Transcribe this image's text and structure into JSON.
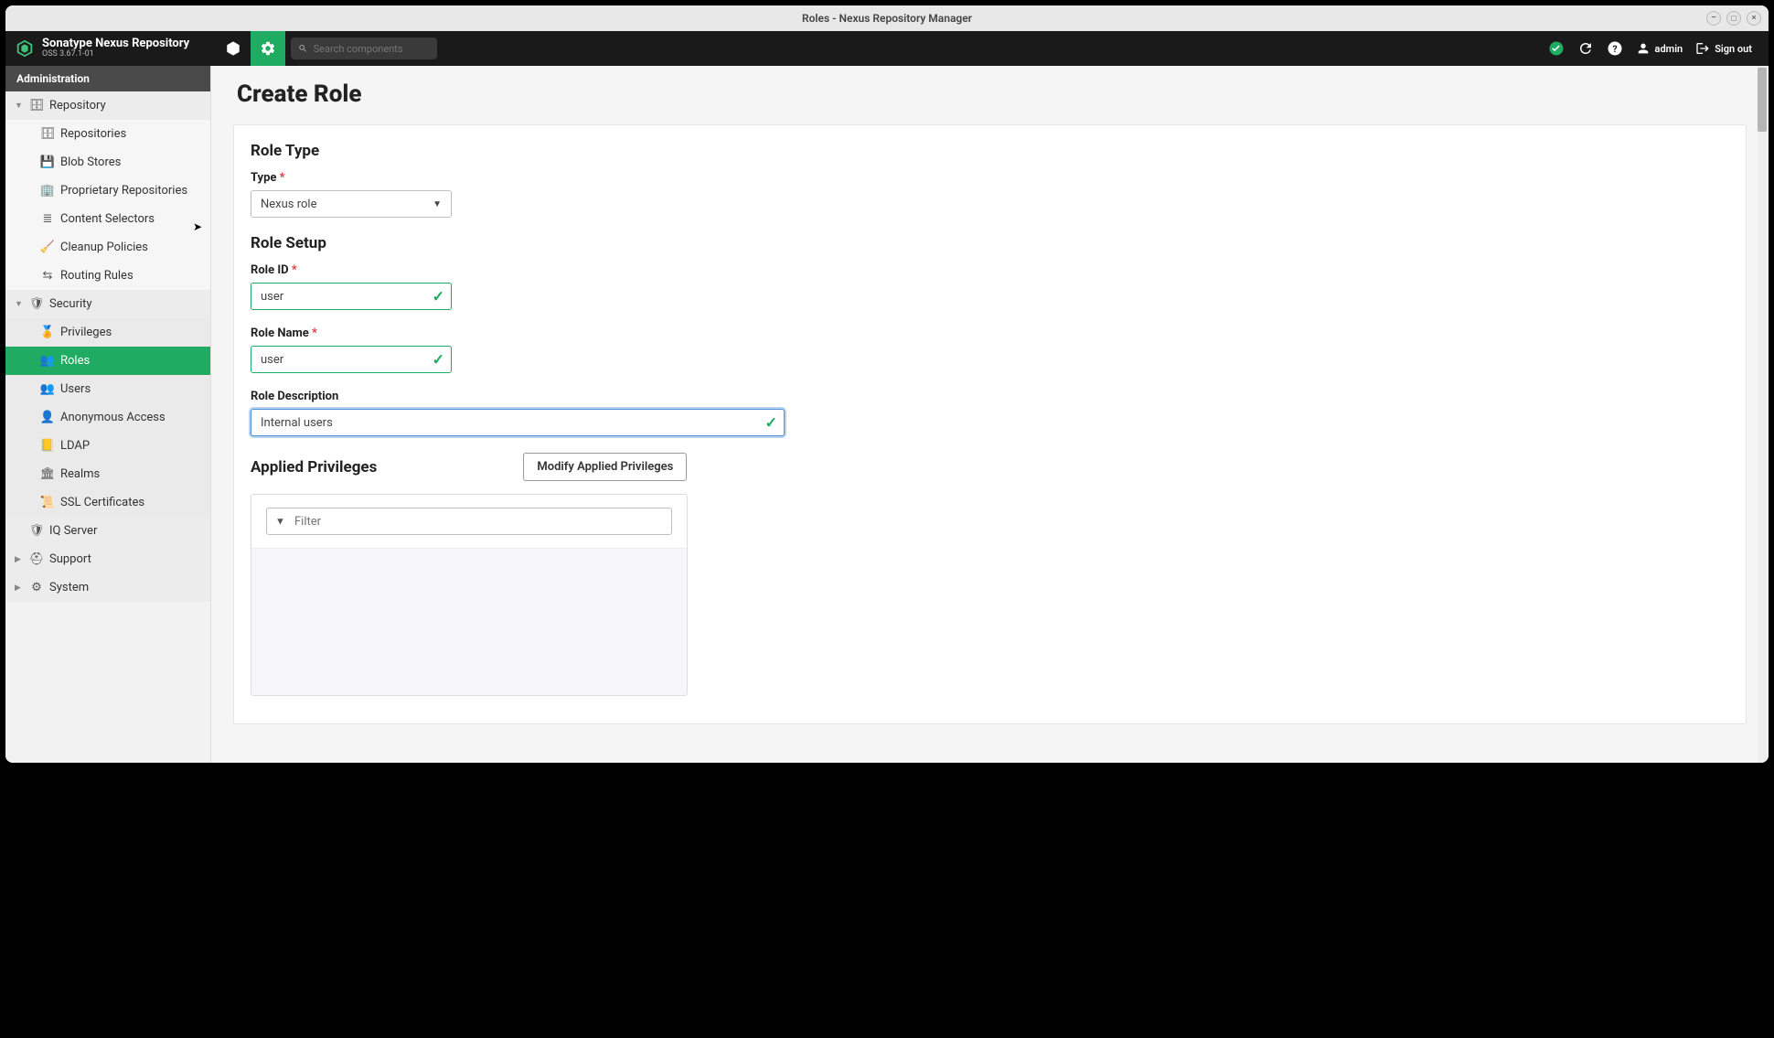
{
  "window": {
    "title": "Roles - Nexus Repository Manager"
  },
  "brand": {
    "title": "Sonatype Nexus Repository",
    "version": "OSS 3.67.1-01"
  },
  "search": {
    "placeholder": "Search components"
  },
  "user": {
    "name": "admin",
    "signout": "Sign out"
  },
  "sidebar": {
    "header": "Administration",
    "repository": {
      "label": "Repository"
    },
    "repository_items": {
      "repositories": "Repositories",
      "blobstores": "Blob Stores",
      "proprietary": "Proprietary Repositories",
      "contentselectors": "Content Selectors",
      "cleanup": "Cleanup Policies",
      "routing": "Routing Rules"
    },
    "security": {
      "label": "Security"
    },
    "security_items": {
      "privileges": "Privileges",
      "roles": "Roles",
      "users": "Users",
      "anonymous": "Anonymous Access",
      "ldap": "LDAP",
      "realms": "Realms",
      "ssl": "SSL Certificates"
    },
    "iqserver": "IQ Server",
    "support": "Support",
    "system": "System"
  },
  "page": {
    "title": "Create Role",
    "role_type_heading": "Role Type",
    "type_label": "Type",
    "type_value": "Nexus role",
    "role_setup_heading": "Role Setup",
    "role_id_label": "Role ID",
    "role_id_value": "user",
    "role_name_label": "Role Name",
    "role_name_value": "user",
    "role_desc_label": "Role Description",
    "role_desc_value": "Internal users",
    "applied_heading": "Applied Privileges",
    "modify_btn": "Modify Applied Privileges",
    "filter_placeholder": "Filter"
  }
}
